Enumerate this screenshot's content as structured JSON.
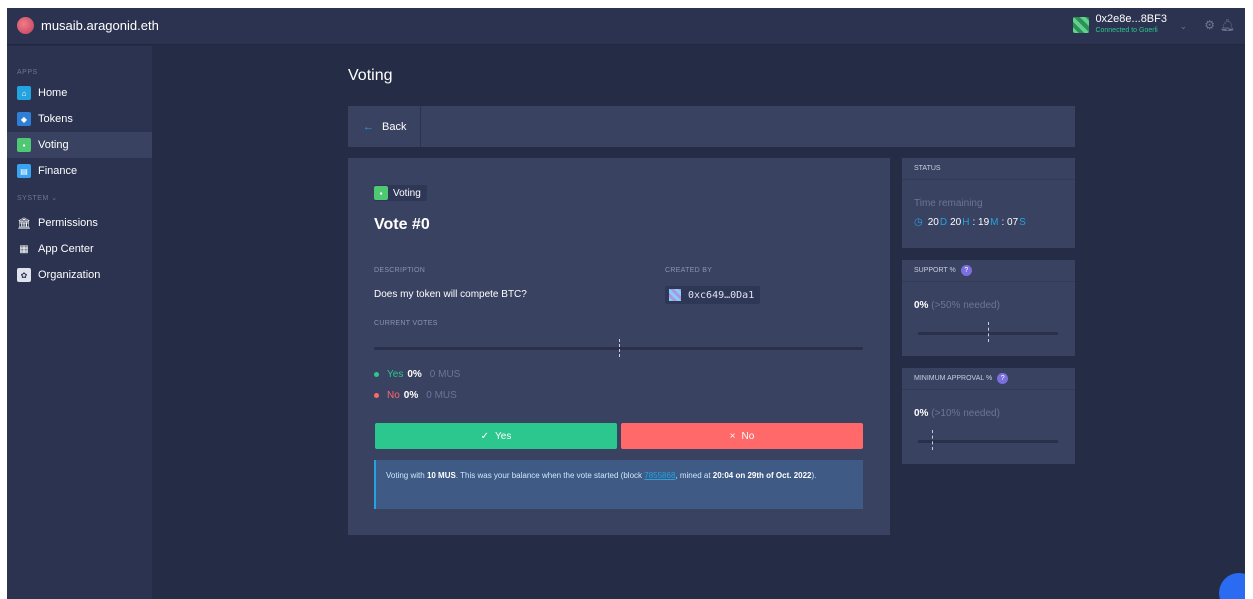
{
  "org": {
    "name": "musaib.aragonid.eth"
  },
  "account": {
    "address": "0x2e8e...8BF3",
    "network_status": "Connected to Goerli"
  },
  "sidebar": {
    "apps_title": "APPS",
    "apps": [
      {
        "label": "Home",
        "icon": "home-icon"
      },
      {
        "label": "Tokens",
        "icon": "tokens-icon"
      },
      {
        "label": "Voting",
        "icon": "voting-icon"
      },
      {
        "label": "Finance",
        "icon": "finance-icon"
      }
    ],
    "system_title": "SYSTEM",
    "system": [
      {
        "label": "Permissions",
        "icon": "permissions-icon"
      },
      {
        "label": "App Center",
        "icon": "app-center-icon"
      },
      {
        "label": "Organization",
        "icon": "organization-icon"
      }
    ]
  },
  "page": {
    "title": "Voting",
    "back_label": "Back"
  },
  "vote": {
    "app_badge": "Voting",
    "title": "Vote #0",
    "description_label": "DESCRIPTION",
    "description": "Does my token will compete BTC?",
    "created_by_label": "CREATED BY",
    "creator": "0xc649…0Da1",
    "current_votes_label": "CURRENT VOTES",
    "yes": {
      "label": "Yes",
      "pct": "0%",
      "amount": "0 MUS"
    },
    "no": {
      "label": "No",
      "pct": "0%",
      "amount": "0 MUS"
    },
    "yes_button": "Yes",
    "no_button": "No",
    "info": {
      "pre": "Voting with",
      "balance": "10 MUS",
      "mid": ". This was your balance when the vote started (block",
      "block": "7855868",
      "post": ", mined at",
      "mined": "20:04 on 29th of Oct. 2022",
      "end": ")."
    }
  },
  "status": {
    "title": "STATUS",
    "time_remaining_label": "Time remaining",
    "days": "20",
    "d_unit": "D",
    "hours": "20",
    "h_unit": "H",
    "minutes": "19",
    "m_unit": "M",
    "seconds": "07",
    "s_unit": "S"
  },
  "support": {
    "title": "SUPPORT %",
    "value": "0%",
    "needed": "(>50% needed)",
    "threshold_fraction": 0.5
  },
  "approval": {
    "title": "MINIMUM APPROVAL %",
    "value": "0%",
    "needed": "(>10% needed)",
    "threshold_fraction": 0.1
  },
  "colors": {
    "accent": "#23a3e0",
    "yes": "#2cc68f",
    "no": "#ff6969",
    "background": "#252c45",
    "surface": "#3a4262"
  }
}
